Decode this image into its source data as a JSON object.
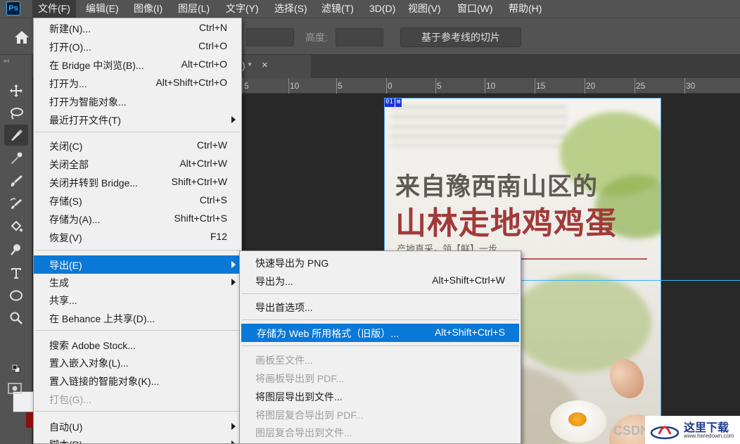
{
  "app": {
    "logo": "Ps",
    "menu_items": [
      "文件(F)",
      "编辑(E)",
      "图像(I)",
      "图层(L)",
      "文字(Y)",
      "选择(S)",
      "滤镜(T)",
      "3D(D)",
      "视图(V)",
      "窗口(W)",
      "帮助(H)"
    ]
  },
  "options_bar": {
    "height_label": "高度:",
    "slice_button": "基于参考线的切片"
  },
  "document_tab": {
    "title_fragment": ") *",
    "close": "×"
  },
  "ruler": {
    "labels": [
      "5",
      "10",
      "5",
      "0",
      "5",
      "10",
      "15",
      "20",
      "25",
      "30"
    ]
  },
  "artboard": {
    "badge_number": "01",
    "headline_1": "来自豫西南山区的",
    "headline_2": "山林走地鸡鸡蛋",
    "subline": "产地直采，领【鲜】一步"
  },
  "file_menu": {
    "items": [
      {
        "label": "新建(N)...",
        "shortcut": "Ctrl+N"
      },
      {
        "label": "打开(O)...",
        "shortcut": "Ctrl+O"
      },
      {
        "label": "在 Bridge 中浏览(B)...",
        "shortcut": "Alt+Ctrl+O"
      },
      {
        "label": "打开为...",
        "shortcut": "Alt+Shift+Ctrl+O"
      },
      {
        "label": "打开为智能对象...",
        "shortcut": ""
      },
      {
        "label": "最近打开文件(T)",
        "shortcut": ""
      },
      {
        "label": "关闭(C)",
        "shortcut": "Ctrl+W"
      },
      {
        "label": "关闭全部",
        "shortcut": "Alt+Ctrl+W"
      },
      {
        "label": "关闭并转到 Bridge...",
        "shortcut": "Shift+Ctrl+W"
      },
      {
        "label": "存储(S)",
        "shortcut": "Ctrl+S"
      },
      {
        "label": "存储为(A)...",
        "shortcut": "Shift+Ctrl+S"
      },
      {
        "label": "恢复(V)",
        "shortcut": "F12"
      },
      {
        "label": "导出(E)",
        "shortcut": ""
      },
      {
        "label": "生成",
        "shortcut": ""
      },
      {
        "label": "共享...",
        "shortcut": ""
      },
      {
        "label": "在 Behance 上共享(D)...",
        "shortcut": ""
      },
      {
        "label": "搜索 Adobe Stock...",
        "shortcut": ""
      },
      {
        "label": "置入嵌入对象(L)...",
        "shortcut": ""
      },
      {
        "label": "置入链接的智能对象(K)...",
        "shortcut": ""
      },
      {
        "label": "打包(G)...",
        "shortcut": ""
      },
      {
        "label": "自动(U)",
        "shortcut": ""
      },
      {
        "label": "脚本(R)",
        "shortcut": ""
      }
    ]
  },
  "export_menu": {
    "items": [
      {
        "label": "快速导出为 PNG",
        "shortcut": ""
      },
      {
        "label": "导出为...",
        "shortcut": "Alt+Shift+Ctrl+W"
      },
      {
        "label": "导出首选项...",
        "shortcut": ""
      },
      {
        "label": "存储为 Web 所用格式（旧版）...",
        "shortcut": "Alt+Shift+Ctrl+S"
      },
      {
        "label": "画板至文件...",
        "shortcut": ""
      },
      {
        "label": "将画板导出到 PDF...",
        "shortcut": ""
      },
      {
        "label": "将图层导出到文件...",
        "shortcut": ""
      },
      {
        "label": "将图层复合导出到 PDF...",
        "shortcut": ""
      },
      {
        "label": "图层复合导出到文件...",
        "shortcut": ""
      }
    ]
  },
  "watermark": {
    "csdn": "CSDN",
    "site_name": "这里下载",
    "site_url": "www.heredown.com"
  },
  "colors": {
    "highlight": "#0a78d7",
    "headline_red": "#a13a3a",
    "guide": "#31b5ff"
  }
}
